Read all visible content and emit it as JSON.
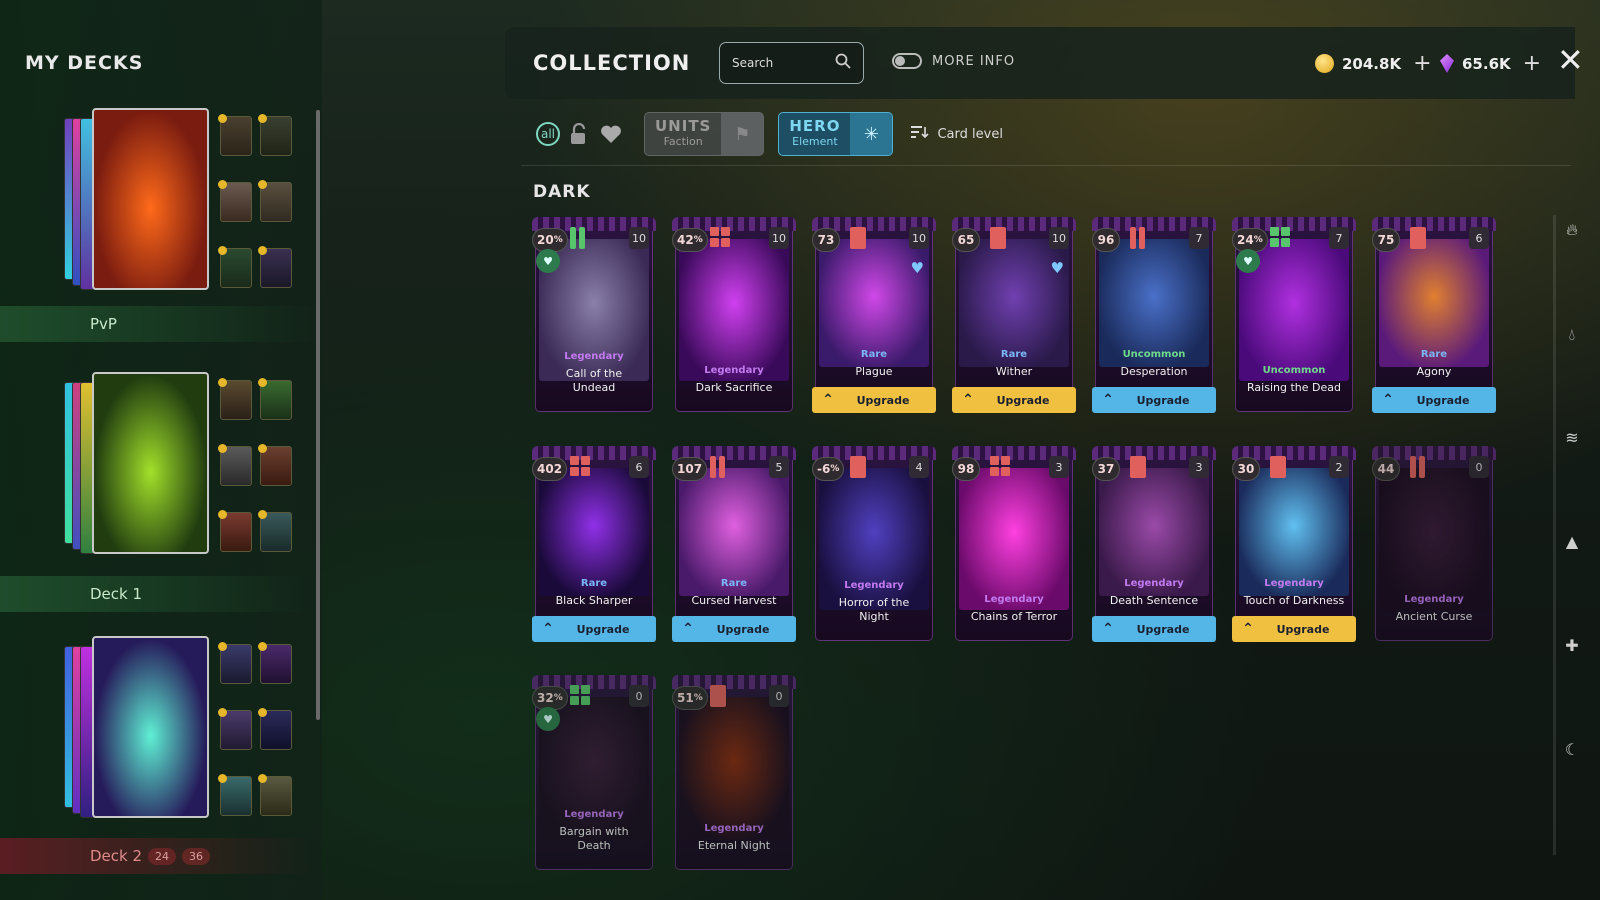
{
  "decks_panel": {
    "title": "MY DECKS",
    "decks": [
      {
        "label": "PvP",
        "art_colors": [
          "#7a1c10",
          "#ff6a1a"
        ],
        "label_bg": "#1f4d2c",
        "label_color": "#c9e8c9"
      },
      {
        "label": "Deck 1",
        "art_colors": [
          "#213d10",
          "#a2e02a"
        ],
        "label_bg": "#1f4d2c",
        "label_color": "#c9e8c9"
      },
      {
        "label": "Deck 2",
        "counts": [
          "24",
          "36"
        ],
        "art_colors": [
          "#261b5a",
          "#5ff0d4"
        ],
        "label_bg": "#5a1e22",
        "label_color": "#e08a8a"
      }
    ]
  },
  "header": {
    "title": "COLLECTION",
    "search_placeholder": "Search",
    "more_info_label": "MORE INFO",
    "gold": "204.8K",
    "gems": "65.6K"
  },
  "filters": {
    "units_label": "UNITS",
    "units_sub": "Faction",
    "hero_label": "HERO",
    "hero_sub": "Element",
    "card_level_label": "Card level"
  },
  "section_title": "DARK",
  "colors": {
    "legendary": "#c27af0",
    "rare": "#7ab6f5",
    "uncommon": "#6fdb8a",
    "bar_green": "#58c46b",
    "bar_red": "#e0605e"
  },
  "cards": [
    {
      "cost": "20",
      "pct": "%",
      "level": "10",
      "rarity": "Legendary",
      "name": "Call of the Undead",
      "upgrade": null,
      "bar": "green2",
      "fav": true,
      "art": [
        "#3a2a55",
        "#8a80aa"
      ]
    },
    {
      "cost": "42",
      "pct": "%",
      "level": "10",
      "rarity": "Legendary",
      "name": "Dark Sacrifice",
      "upgrade": null,
      "bar": "red4",
      "fav": false,
      "art": [
        "#3a0a5a",
        "#d040f0"
      ]
    },
    {
      "cost": "73",
      "pct": "",
      "level": "10",
      "rarity": "Rare",
      "name": "Plague",
      "upgrade": "Upgrade",
      "upgrade_color": "gold",
      "bar": "red1",
      "fav": false,
      "heart": true,
      "art": [
        "#3a1a6a",
        "#d048e8"
      ]
    },
    {
      "cost": "65",
      "pct": "",
      "level": "10",
      "rarity": "Rare",
      "name": "Wither",
      "upgrade": "Upgrade",
      "upgrade_color": "gold",
      "bar": "red1",
      "fav": false,
      "heart": true,
      "art": [
        "#2a1a4a",
        "#7040b0"
      ]
    },
    {
      "cost": "96",
      "pct": "",
      "level": "7",
      "rarity": "Uncommon",
      "name": "Desperation",
      "upgrade": "Upgrade",
      "upgrade_color": "blue",
      "bar": "red2",
      "fav": false,
      "art": [
        "#1a2a5a",
        "#4a70c8"
      ]
    },
    {
      "cost": "24",
      "pct": "%",
      "level": "7",
      "rarity": "Uncommon",
      "name": "Raising the Dead",
      "upgrade": null,
      "bar": "green4",
      "fav": true,
      "art": [
        "#4a0a7a",
        "#b030e0"
      ]
    },
    {
      "cost": "75",
      "pct": "",
      "level": "6",
      "rarity": "Rare",
      "name": "Agony",
      "upgrade": "Upgrade",
      "upgrade_color": "blue",
      "bar": "red1",
      "fav": false,
      "art": [
        "#5a1a7a",
        "#e08030"
      ]
    },
    {
      "cost": "402",
      "pct": "",
      "level": "6",
      "rarity": "Rare",
      "name": "Black Sharper",
      "upgrade": "Upgrade",
      "upgrade_color": "blue",
      "bar": "red4",
      "fav": false,
      "art": [
        "#1a0a3a",
        "#9030e8"
      ]
    },
    {
      "cost": "107",
      "pct": "",
      "level": "5",
      "rarity": "Rare",
      "name": "Cursed Harvest",
      "upgrade": "Upgrade",
      "upgrade_color": "blue",
      "bar": "red2",
      "fav": false,
      "art": [
        "#4a1a6a",
        "#e060e0"
      ]
    },
    {
      "cost": "-6",
      "pct": "%",
      "level": "4",
      "rarity": "Legendary",
      "name": "Horror of the Night",
      "upgrade": null,
      "bar": "red1",
      "fav": false,
      "art": [
        "#1a1040",
        "#5040c0"
      ]
    },
    {
      "cost": "98",
      "pct": "",
      "level": "3",
      "rarity": "Legendary",
      "name": "Chains of Terror",
      "upgrade": null,
      "bar": "red4",
      "fav": false,
      "art": [
        "#6a0a6a",
        "#ff40e0"
      ]
    },
    {
      "cost": "37",
      "pct": "",
      "level": "3",
      "rarity": "Legendary",
      "name": "Death Sentence",
      "upgrade": "Upgrade",
      "upgrade_color": "blue",
      "bar": "red1",
      "fav": false,
      "art": [
        "#3a1a4a",
        "#9a4aa8"
      ]
    },
    {
      "cost": "30",
      "pct": "",
      "level": "2",
      "rarity": "Legendary",
      "name": "Touch of Darkness",
      "upgrade": "Upgrade",
      "upgrade_color": "gold",
      "bar": "red1",
      "fav": false,
      "art": [
        "#1a2a5a",
        "#60c0f0"
      ]
    },
    {
      "cost": "44",
      "pct": "",
      "level": "0",
      "rarity": "Legendary",
      "name": "Ancient Curse",
      "upgrade": null,
      "bar": "red2",
      "fav": false,
      "dim": true,
      "art": [
        "#1a0a20",
        "#3a1a3a"
      ]
    },
    {
      "cost": "32",
      "pct": "%",
      "level": "0",
      "rarity": "Legendary",
      "name": "Bargain with Death",
      "upgrade": null,
      "bar": "green4",
      "fav": true,
      "dim": true,
      "art": [
        "#1a0a20",
        "#3a1a3a"
      ]
    },
    {
      "cost": "51",
      "pct": "%",
      "level": "0",
      "rarity": "Legendary",
      "name": "Eternal Night",
      "upgrade": null,
      "bar": "red1",
      "fav": false,
      "dim": true,
      "art": [
        "#1a0a20",
        "#8a2a10"
      ]
    }
  ],
  "right_rail_icons": [
    "fire-icon",
    "water-icon",
    "wind-icon",
    "earth-icon",
    "light-icon",
    "dark-icon"
  ]
}
